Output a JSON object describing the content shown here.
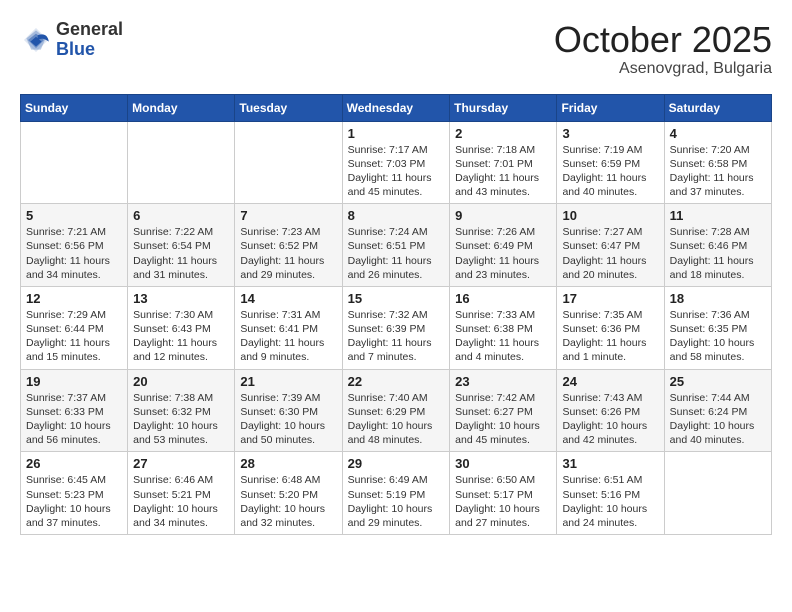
{
  "header": {
    "logo_general": "General",
    "logo_blue": "Blue",
    "month": "October 2025",
    "location": "Asenovgrad, Bulgaria"
  },
  "days_of_week": [
    "Sunday",
    "Monday",
    "Tuesday",
    "Wednesday",
    "Thursday",
    "Friday",
    "Saturday"
  ],
  "weeks": [
    [
      {
        "day": "",
        "sunrise": "",
        "sunset": "",
        "daylight": ""
      },
      {
        "day": "",
        "sunrise": "",
        "sunset": "",
        "daylight": ""
      },
      {
        "day": "",
        "sunrise": "",
        "sunset": "",
        "daylight": ""
      },
      {
        "day": "1",
        "sunrise": "Sunrise: 7:17 AM",
        "sunset": "Sunset: 7:03 PM",
        "daylight": "Daylight: 11 hours and 45 minutes."
      },
      {
        "day": "2",
        "sunrise": "Sunrise: 7:18 AM",
        "sunset": "Sunset: 7:01 PM",
        "daylight": "Daylight: 11 hours and 43 minutes."
      },
      {
        "day": "3",
        "sunrise": "Sunrise: 7:19 AM",
        "sunset": "Sunset: 6:59 PM",
        "daylight": "Daylight: 11 hours and 40 minutes."
      },
      {
        "day": "4",
        "sunrise": "Sunrise: 7:20 AM",
        "sunset": "Sunset: 6:58 PM",
        "daylight": "Daylight: 11 hours and 37 minutes."
      }
    ],
    [
      {
        "day": "5",
        "sunrise": "Sunrise: 7:21 AM",
        "sunset": "Sunset: 6:56 PM",
        "daylight": "Daylight: 11 hours and 34 minutes."
      },
      {
        "day": "6",
        "sunrise": "Sunrise: 7:22 AM",
        "sunset": "Sunset: 6:54 PM",
        "daylight": "Daylight: 11 hours and 31 minutes."
      },
      {
        "day": "7",
        "sunrise": "Sunrise: 7:23 AM",
        "sunset": "Sunset: 6:52 PM",
        "daylight": "Daylight: 11 hours and 29 minutes."
      },
      {
        "day": "8",
        "sunrise": "Sunrise: 7:24 AM",
        "sunset": "Sunset: 6:51 PM",
        "daylight": "Daylight: 11 hours and 26 minutes."
      },
      {
        "day": "9",
        "sunrise": "Sunrise: 7:26 AM",
        "sunset": "Sunset: 6:49 PM",
        "daylight": "Daylight: 11 hours and 23 minutes."
      },
      {
        "day": "10",
        "sunrise": "Sunrise: 7:27 AM",
        "sunset": "Sunset: 6:47 PM",
        "daylight": "Daylight: 11 hours and 20 minutes."
      },
      {
        "day": "11",
        "sunrise": "Sunrise: 7:28 AM",
        "sunset": "Sunset: 6:46 PM",
        "daylight": "Daylight: 11 hours and 18 minutes."
      }
    ],
    [
      {
        "day": "12",
        "sunrise": "Sunrise: 7:29 AM",
        "sunset": "Sunset: 6:44 PM",
        "daylight": "Daylight: 11 hours and 15 minutes."
      },
      {
        "day": "13",
        "sunrise": "Sunrise: 7:30 AM",
        "sunset": "Sunset: 6:43 PM",
        "daylight": "Daylight: 11 hours and 12 minutes."
      },
      {
        "day": "14",
        "sunrise": "Sunrise: 7:31 AM",
        "sunset": "Sunset: 6:41 PM",
        "daylight": "Daylight: 11 hours and 9 minutes."
      },
      {
        "day": "15",
        "sunrise": "Sunrise: 7:32 AM",
        "sunset": "Sunset: 6:39 PM",
        "daylight": "Daylight: 11 hours and 7 minutes."
      },
      {
        "day": "16",
        "sunrise": "Sunrise: 7:33 AM",
        "sunset": "Sunset: 6:38 PM",
        "daylight": "Daylight: 11 hours and 4 minutes."
      },
      {
        "day": "17",
        "sunrise": "Sunrise: 7:35 AM",
        "sunset": "Sunset: 6:36 PM",
        "daylight": "Daylight: 11 hours and 1 minute."
      },
      {
        "day": "18",
        "sunrise": "Sunrise: 7:36 AM",
        "sunset": "Sunset: 6:35 PM",
        "daylight": "Daylight: 10 hours and 58 minutes."
      }
    ],
    [
      {
        "day": "19",
        "sunrise": "Sunrise: 7:37 AM",
        "sunset": "Sunset: 6:33 PM",
        "daylight": "Daylight: 10 hours and 56 minutes."
      },
      {
        "day": "20",
        "sunrise": "Sunrise: 7:38 AM",
        "sunset": "Sunset: 6:32 PM",
        "daylight": "Daylight: 10 hours and 53 minutes."
      },
      {
        "day": "21",
        "sunrise": "Sunrise: 7:39 AM",
        "sunset": "Sunset: 6:30 PM",
        "daylight": "Daylight: 10 hours and 50 minutes."
      },
      {
        "day": "22",
        "sunrise": "Sunrise: 7:40 AM",
        "sunset": "Sunset: 6:29 PM",
        "daylight": "Daylight: 10 hours and 48 minutes."
      },
      {
        "day": "23",
        "sunrise": "Sunrise: 7:42 AM",
        "sunset": "Sunset: 6:27 PM",
        "daylight": "Daylight: 10 hours and 45 minutes."
      },
      {
        "day": "24",
        "sunrise": "Sunrise: 7:43 AM",
        "sunset": "Sunset: 6:26 PM",
        "daylight": "Daylight: 10 hours and 42 minutes."
      },
      {
        "day": "25",
        "sunrise": "Sunrise: 7:44 AM",
        "sunset": "Sunset: 6:24 PM",
        "daylight": "Daylight: 10 hours and 40 minutes."
      }
    ],
    [
      {
        "day": "26",
        "sunrise": "Sunrise: 6:45 AM",
        "sunset": "Sunset: 5:23 PM",
        "daylight": "Daylight: 10 hours and 37 minutes."
      },
      {
        "day": "27",
        "sunrise": "Sunrise: 6:46 AM",
        "sunset": "Sunset: 5:21 PM",
        "daylight": "Daylight: 10 hours and 34 minutes."
      },
      {
        "day": "28",
        "sunrise": "Sunrise: 6:48 AM",
        "sunset": "Sunset: 5:20 PM",
        "daylight": "Daylight: 10 hours and 32 minutes."
      },
      {
        "day": "29",
        "sunrise": "Sunrise: 6:49 AM",
        "sunset": "Sunset: 5:19 PM",
        "daylight": "Daylight: 10 hours and 29 minutes."
      },
      {
        "day": "30",
        "sunrise": "Sunrise: 6:50 AM",
        "sunset": "Sunset: 5:17 PM",
        "daylight": "Daylight: 10 hours and 27 minutes."
      },
      {
        "day": "31",
        "sunrise": "Sunrise: 6:51 AM",
        "sunset": "Sunset: 5:16 PM",
        "daylight": "Daylight: 10 hours and 24 minutes."
      },
      {
        "day": "",
        "sunrise": "",
        "sunset": "",
        "daylight": ""
      }
    ]
  ]
}
